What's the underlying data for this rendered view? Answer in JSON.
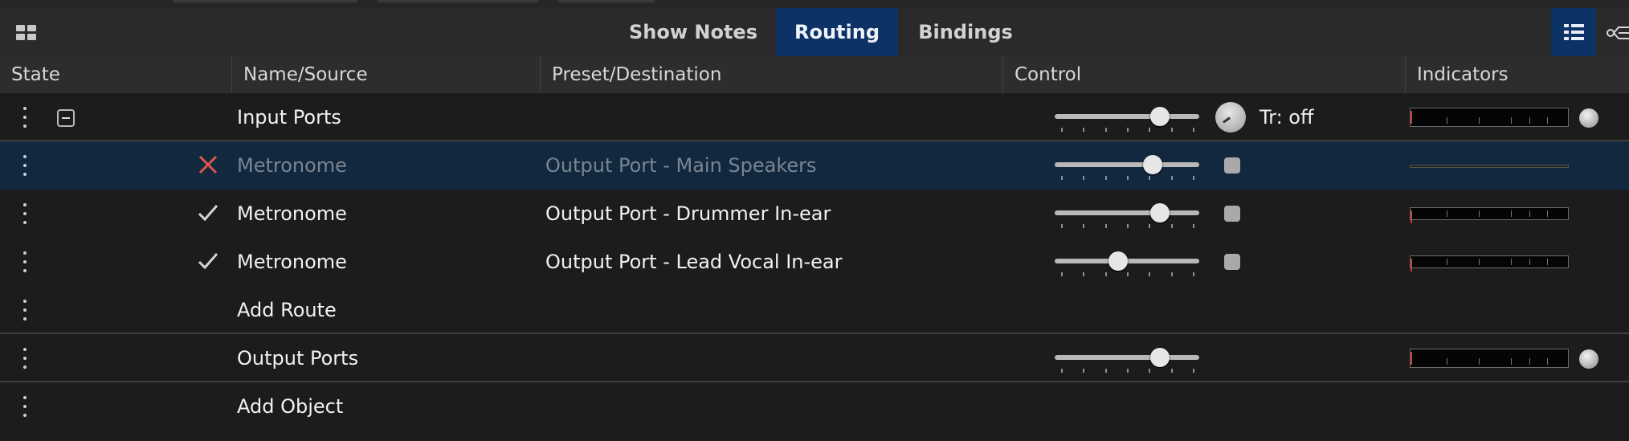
{
  "tabs": [
    {
      "label": "Show Notes",
      "active": false
    },
    {
      "label": "Routing",
      "active": true
    },
    {
      "label": "Bindings",
      "active": false
    }
  ],
  "columns": [
    "State",
    "Name/Source",
    "Preset/Destination",
    "Control",
    "Indicators"
  ],
  "rows": [
    {
      "kind": "group",
      "name": "Input Ports",
      "destination": "",
      "slider": 0.73,
      "knob": true,
      "transpose": "Tr: off",
      "meter": true,
      "led": true
    },
    {
      "kind": "route",
      "state": "disabled",
      "name": "Metronome",
      "destination": "Output Port - Main Speakers",
      "slider": 0.68,
      "mute": true,
      "meter": "thin",
      "selected": true
    },
    {
      "kind": "route",
      "state": "enabled",
      "name": "Metronome",
      "destination": "Output Port - Drummer In-ear",
      "slider": 0.73,
      "mute": true,
      "meter": true
    },
    {
      "kind": "route",
      "state": "enabled",
      "name": "Metronome",
      "destination": "Output Port - Lead Vocal In-ear",
      "slider": 0.44,
      "mute": true,
      "meter": true
    },
    {
      "kind": "add",
      "name": "Add Route"
    },
    {
      "kind": "group",
      "name": "Output Ports",
      "destination": "",
      "slider": 0.73,
      "meter": true,
      "led": true
    },
    {
      "kind": "add",
      "name": "Add Object"
    }
  ],
  "colors": {
    "accent": "#0d3366",
    "selected_row": "#12283f",
    "error": "#e0554a"
  },
  "icons": {
    "grid": "grid-view-icon",
    "list": "list-view-icon",
    "routing": "routing-icon",
    "enabled": "check-icon",
    "disabled": "x-icon",
    "collapse": "collapse-icon",
    "drag": "drag-handle-icon"
  }
}
